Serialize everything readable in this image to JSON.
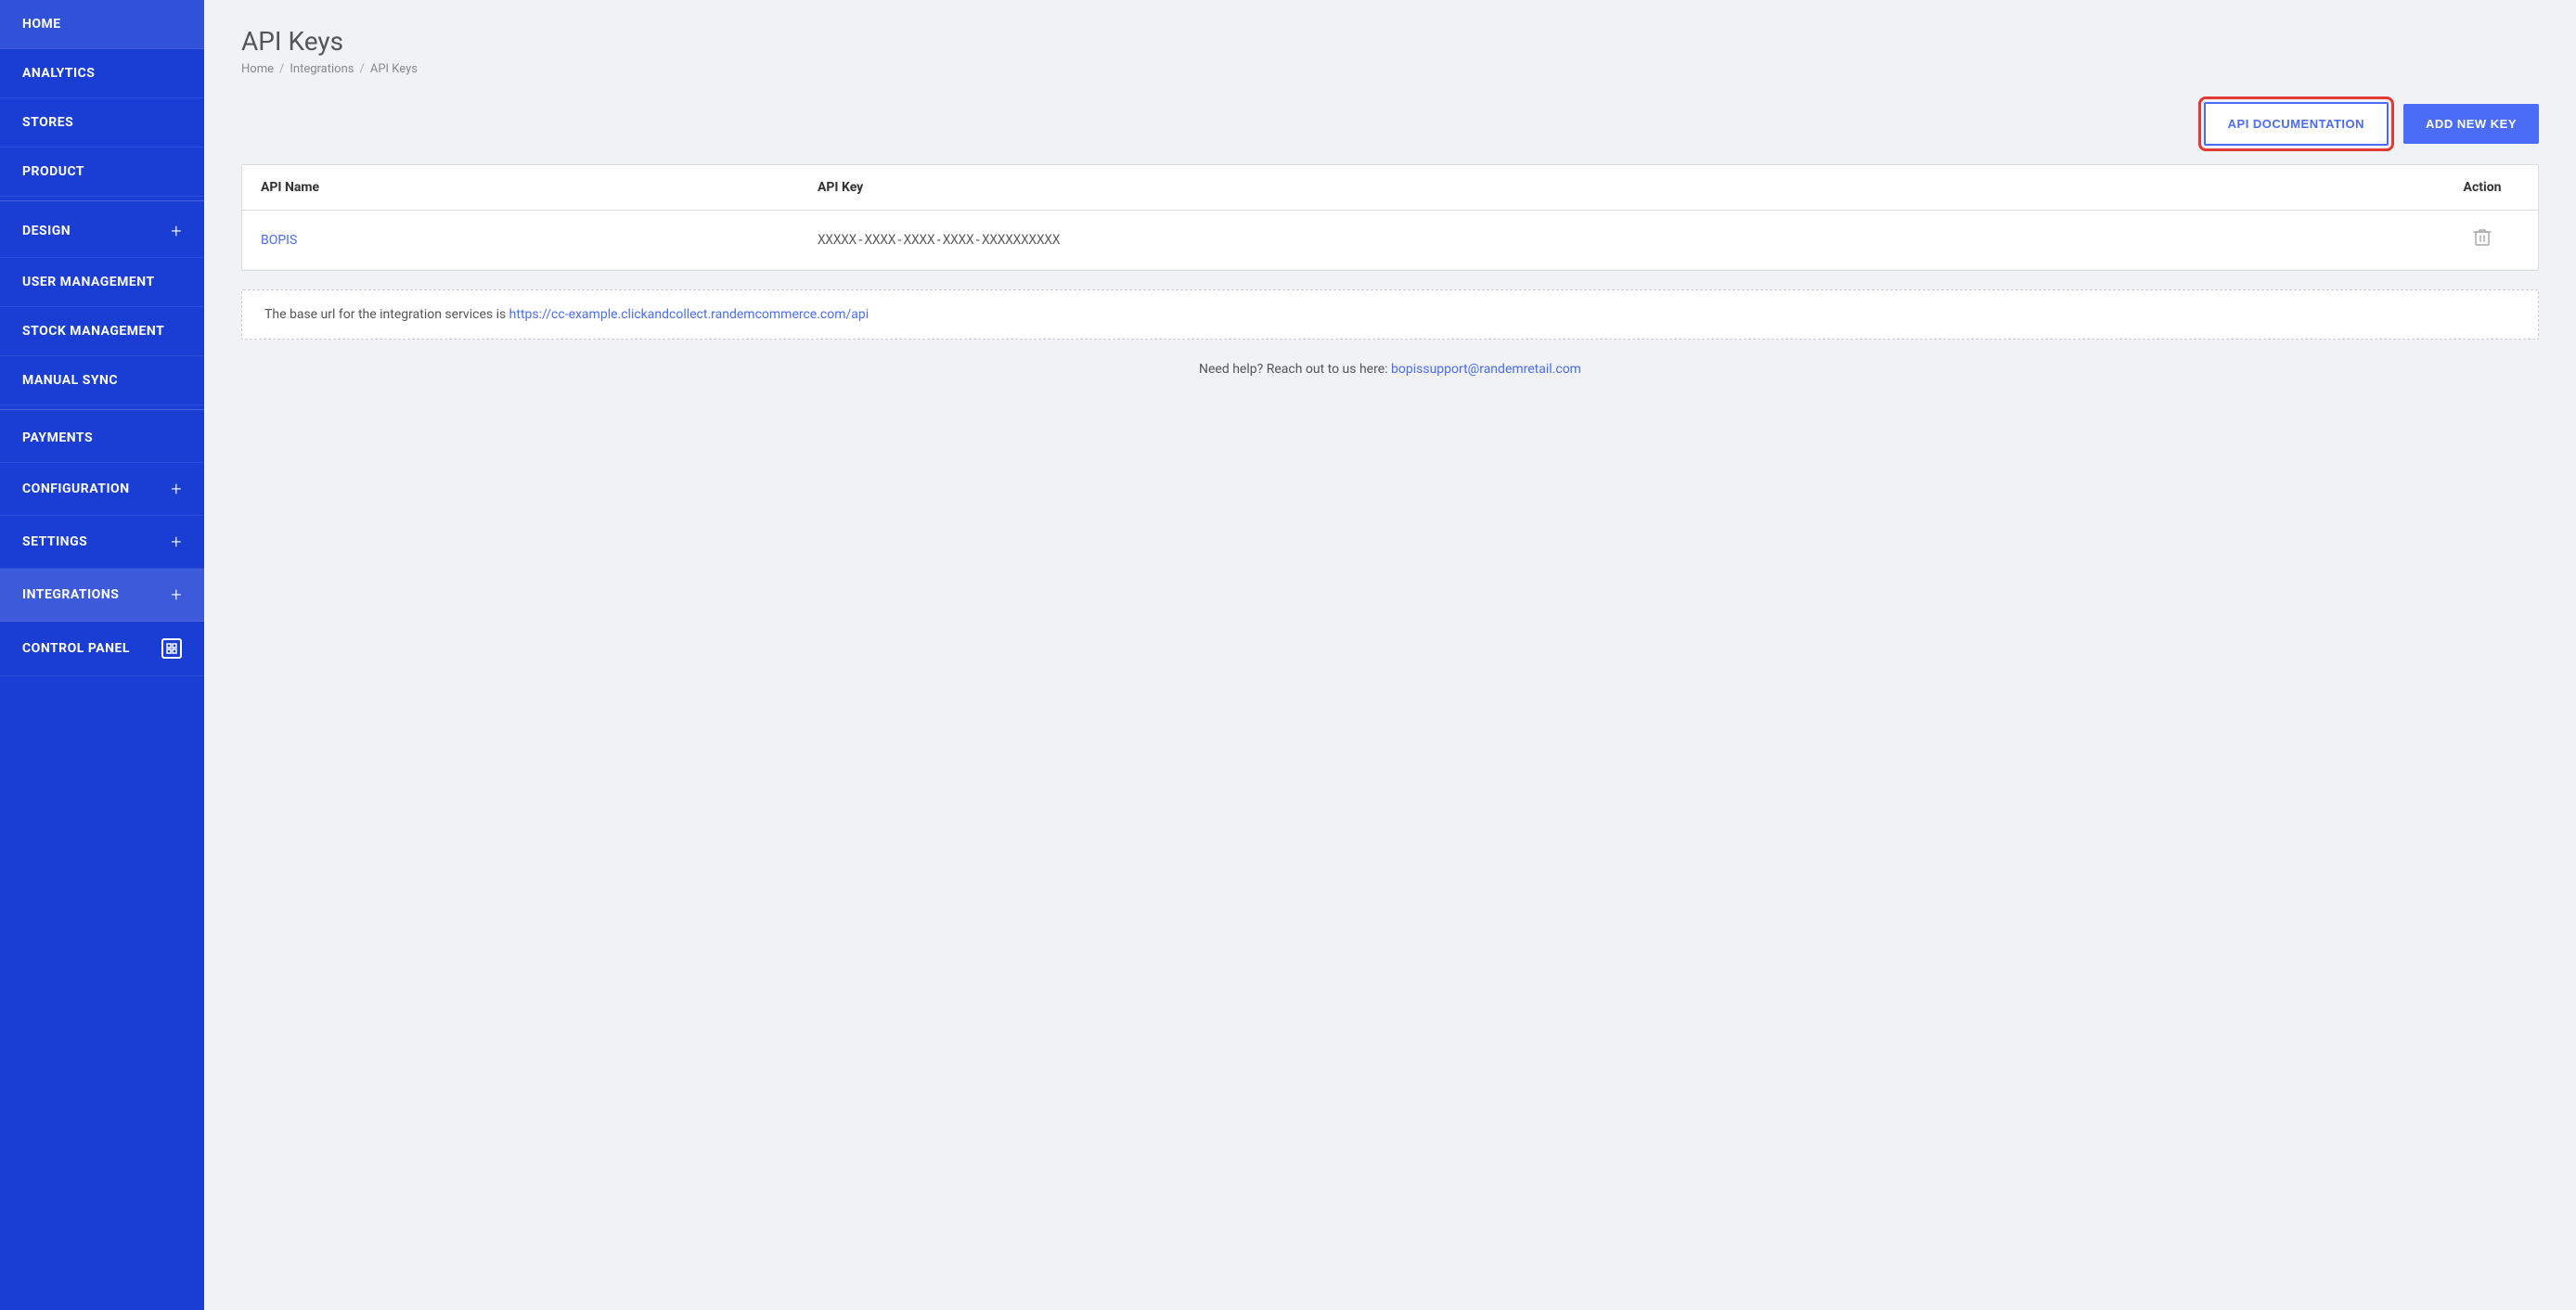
{
  "sidebar": {
    "items": [
      {
        "label": "HOME",
        "has_plus": false,
        "has_icon": false
      },
      {
        "label": "ANALYTICS",
        "has_plus": false,
        "has_icon": false
      },
      {
        "label": "STORES",
        "has_plus": false,
        "has_icon": false
      },
      {
        "label": "PRODUCT",
        "has_plus": false,
        "has_icon": false
      },
      {
        "label": "DESIGN",
        "has_plus": true,
        "has_icon": false
      },
      {
        "label": "USER MANAGEMENT",
        "has_plus": false,
        "has_icon": false
      },
      {
        "label": "STOCK MANAGEMENT",
        "has_plus": false,
        "has_icon": false
      },
      {
        "label": "MANUAL SYNC",
        "has_plus": false,
        "has_icon": false
      },
      {
        "label": "PAYMENTS",
        "has_plus": false,
        "has_icon": false
      },
      {
        "label": "CONFIGURATION",
        "has_plus": true,
        "has_icon": false
      },
      {
        "label": "SETTINGS",
        "has_plus": true,
        "has_icon": false
      },
      {
        "label": "INTEGRATIONS",
        "has_plus": true,
        "has_icon": false
      },
      {
        "label": "CONTROL PANEL",
        "has_plus": false,
        "has_icon": true
      }
    ]
  },
  "page": {
    "title": "API Keys",
    "breadcrumb": {
      "home": "Home",
      "sep1": "/",
      "integrations": "Integrations",
      "sep2": "/",
      "current": "API Keys"
    }
  },
  "actions": {
    "api_docs_label": "API DOCUMENTATION",
    "add_key_label": "ADD NEW KEY"
  },
  "table": {
    "columns": {
      "name": "API Name",
      "key": "API Key",
      "action": "Action"
    },
    "rows": [
      {
        "name": "BOPIS",
        "key": "XXXXX-XXXX-XXXX-XXXX-XXXXXXXXXX"
      }
    ]
  },
  "info": {
    "base_url_text": "The base url for the integration services is ",
    "base_url_link": "https://cc-example.clickandcollect.randemcommerce.com/api"
  },
  "help": {
    "text": "Need help? Reach out to us here: ",
    "email": "bopissupport@randemretail.com"
  }
}
